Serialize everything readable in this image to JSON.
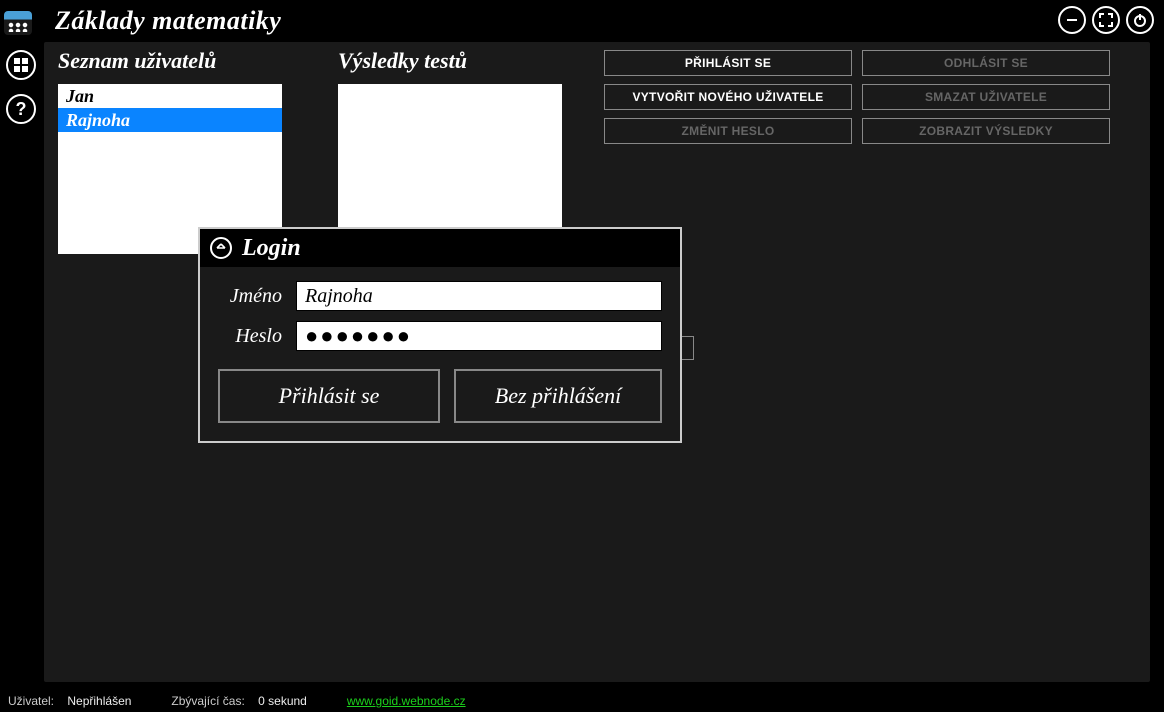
{
  "app": {
    "title": "Základy matematiky"
  },
  "sections": {
    "users": "Seznam uživatelů",
    "results": "Výsledky testů"
  },
  "users": {
    "items": [
      "Jan",
      "Rajnoha"
    ],
    "selected_index": 1
  },
  "actions": {
    "login": "PŘIHLÁSIT SE",
    "logout": "ODHLÁSIT SE",
    "create_user": "VYTVOŘIT NOVÉHO UŽIVATELE",
    "delete_user": "SMAZAT UŽIVATELE",
    "change_password": "ZMĚNIT HESLO",
    "show_results": "ZOBRAZIT VÝSLEDKY"
  },
  "dialog": {
    "title": "Login",
    "name_label": "Jméno",
    "password_label": "Heslo",
    "name_value": "Rajnoha",
    "password_mask": "●●●●●●●",
    "submit": "Přihlásit se",
    "skip": "Bez přihlášení"
  },
  "status": {
    "user_label": "Uživatel:",
    "user_value": "Nepřihlášen",
    "time_label": "Zbývající čas:",
    "time_value": "0 sekund",
    "link": "www.goid.webnode.cz"
  }
}
